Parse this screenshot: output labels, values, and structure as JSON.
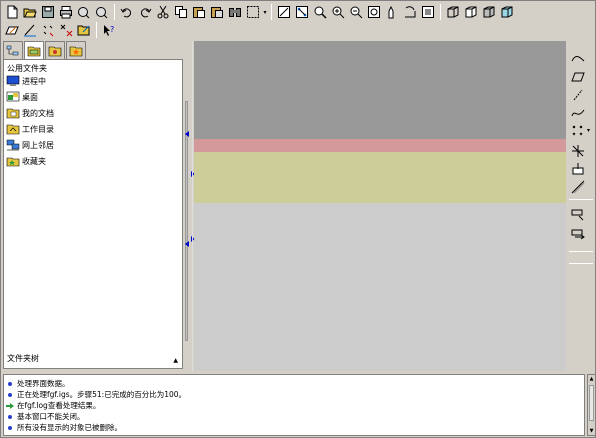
{
  "toolbar": {
    "icons": [
      "new-file-icon",
      "open-folder-icon",
      "save-icon",
      "print-icon",
      "undo-history-icon",
      "redo-history-icon",
      "undo-icon",
      "redo-icon",
      "cut-icon",
      "copy-icon",
      "paste-icon",
      "paste-special-icon",
      "binoculars-icon",
      "select-box-icon",
      "view-sketch-icon",
      "view-tree-icon",
      "query-icon",
      "zoom-in-icon",
      "zoom-out-icon",
      "zoom-window-icon",
      "pan-icon",
      "rotate-icon",
      "refit-icon",
      "wireframe-icon",
      "hidden-line-icon",
      "shaded-icon",
      "view-box-icon"
    ]
  },
  "toolbar2": {
    "icons": [
      "sketch-plane-icon",
      "line-tool-icon",
      "point-tool-icon",
      "delete-point-icon",
      "folder-edit-icon",
      "context-help-icon"
    ]
  },
  "left_panel": {
    "tabs": [
      "model-tree-tab",
      "layers-tab",
      "folder-tab",
      "favorites-tab"
    ],
    "title": "公用文件夹",
    "items": [
      {
        "label": "进程中",
        "icon": "monitor-icon"
      },
      {
        "label": "桌面",
        "icon": "desktop-icon"
      },
      {
        "label": "我的文档",
        "icon": "my-documents-icon"
      },
      {
        "label": "工作目录",
        "icon": "work-directory-icon"
      },
      {
        "label": "网上邻居",
        "icon": "network-icon"
      },
      {
        "label": "收藏夹",
        "icon": "favorites-icon"
      }
    ],
    "footer": "文件夹树"
  },
  "canvas": {
    "colors": {
      "gray": "#999999",
      "pink": "#d4999b",
      "yellow": "#cdcd99",
      "background": "#cccccc"
    }
  },
  "right_toolbar": {
    "icons": [
      "curve-icon",
      "plane-icon",
      "axis-icon",
      "spline-icon",
      "point-set-icon",
      "coordinate-system-icon",
      "datum-plane-icon",
      "datum-axis-icon",
      "datum-point-icon",
      "analysis-icon"
    ]
  },
  "messages": [
    {
      "type": "info",
      "text": "处理界面数据。"
    },
    {
      "type": "info",
      "text": "正在处理fgf.igs。步骤51:已完成的百分比为100。"
    },
    {
      "type": "arrow",
      "text": "在fgf.log查看处理结果。"
    },
    {
      "type": "info",
      "text": "基本窗口不能关闭。"
    },
    {
      "type": "info",
      "text": "所有没有显示的对象已被删除。"
    }
  ]
}
